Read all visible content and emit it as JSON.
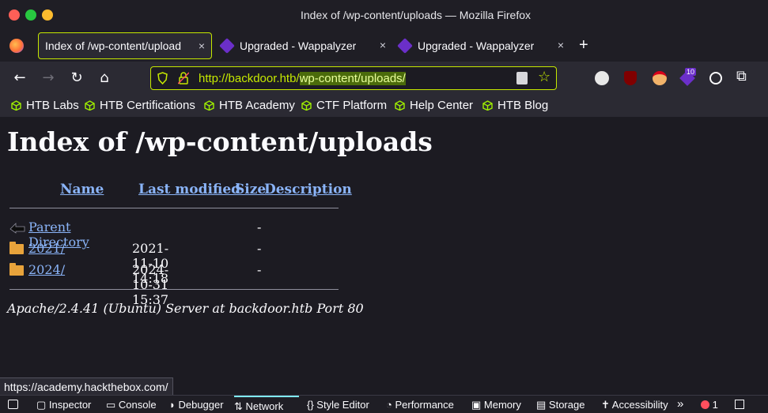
{
  "window": {
    "title": "Index of /wp-content/uploads — Mozilla Firefox"
  },
  "tabs": [
    {
      "label": "Index of /wp-content/upload",
      "active": true
    },
    {
      "label": "Upgraded - Wappalyzer",
      "active": false
    },
    {
      "label": "Upgraded - Wappalyzer",
      "active": false
    }
  ],
  "close_glyph": "×",
  "new_tab_glyph": "+",
  "nav": {
    "url_host": "http://backdoor.htb/",
    "url_path": "wp-content/uploads/"
  },
  "extensions": {
    "badge_count": "10"
  },
  "bookmarks": [
    "HTB Labs",
    "HTB Certifications",
    "HTB Academy",
    "CTF Platform",
    "Help Center",
    "HTB Blog"
  ],
  "page": {
    "heading": "Index of /wp-content/uploads",
    "columns": {
      "name": "Name",
      "modified": "Last modified",
      "size": "Size",
      "description": "Description"
    },
    "rows": [
      {
        "name": "Parent Directory",
        "modified": "",
        "size": "-",
        "icon": "back-icon"
      },
      {
        "name": "2021/",
        "modified": "2021-11-10 14:18",
        "size": "-",
        "icon": "folder-icon"
      },
      {
        "name": "2024/",
        "modified": "2024-10-31 15:37",
        "size": "-",
        "icon": "folder-icon"
      }
    ],
    "footer": "Apache/2.4.41 (Ubuntu) Server at backdoor.htb Port 80"
  },
  "status_link": "https://academy.hackthebox.com/",
  "devtools": {
    "tabs": [
      "Inspector",
      "Console",
      "Debugger",
      "Network",
      "Style Editor",
      "Performance",
      "Memory",
      "Storage",
      "Accessibility"
    ],
    "active": "Network",
    "error_count": "1"
  },
  "colors": {
    "accent": "#c5e800",
    "link": "#8ab4f8",
    "background": "#1c1b22"
  }
}
